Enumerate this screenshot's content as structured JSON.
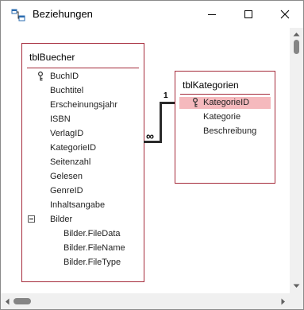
{
  "window": {
    "title": "Beziehungen"
  },
  "tblBuecher": {
    "title": "tblBuecher",
    "fields": [
      "BuchID",
      "Buchtitel",
      "Erscheinungsjahr",
      "ISBN",
      "VerlagID",
      "KategorieID",
      "Seitenzahl",
      "Gelesen",
      "GenreID",
      "Inhaltsangabe",
      "Bilder",
      "Bilder.FileData",
      "Bilder.FileName",
      "Bilder.FileType"
    ]
  },
  "tblKategorien": {
    "title": "tblKategorien",
    "fields": [
      "KategorieID",
      "Kategorie",
      "Beschreibung"
    ]
  },
  "relationship": {
    "one_label": "1",
    "many_label": "∞"
  },
  "colors": {
    "table_border": "#a52a3a",
    "selection": "#f5b9bd"
  }
}
